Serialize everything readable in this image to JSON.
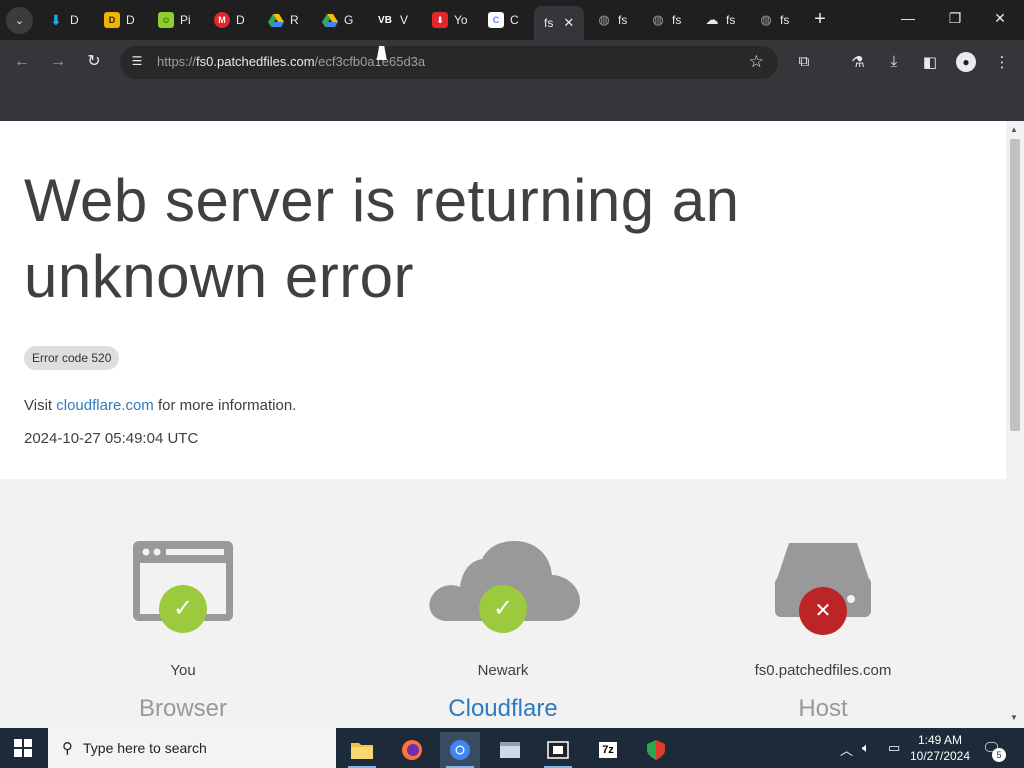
{
  "tabs": [
    {
      "label": "D",
      "icon": "download-icon",
      "color": "#1ea7e1"
    },
    {
      "label": "D",
      "icon": "d-icon",
      "color": "#f0b400"
    },
    {
      "label": "Pi",
      "icon": "smile-icon",
      "color": "#8ad12b"
    },
    {
      "label": "D",
      "icon": "m-icon",
      "color": "#e3262a"
    },
    {
      "label": "R",
      "icon": "drive-icon",
      "color": "#34a853"
    },
    {
      "label": "G",
      "icon": "drive-icon",
      "color": "#34a853"
    },
    {
      "label": "V",
      "icon": "vb-icon",
      "color": "#ffffff"
    },
    {
      "label": "Yo",
      "icon": "download-red-icon",
      "color": "#e3262a"
    },
    {
      "label": "C",
      "icon": "c-icon",
      "color": "#4c8bf5"
    },
    {
      "label": "fs",
      "icon": "",
      "color": "#35363a",
      "active": true
    },
    {
      "label": "fs",
      "icon": "globe-icon",
      "color": "#9aa0a6"
    },
    {
      "label": "fs",
      "icon": "globe-icon",
      "color": "#9aa0a6"
    },
    {
      "label": "fs",
      "icon": "cloud-icon",
      "color": "#e8eaed"
    },
    {
      "label": "fs",
      "icon": "globe-icon",
      "color": "#9aa0a6"
    }
  ],
  "address": {
    "scheme": "https://",
    "host": "fs0.patchedfiles.com",
    "path": "/ecf3cfb0a1e65d3a"
  },
  "page": {
    "headline": "Web server is returning an unknown error",
    "error_code": "Error code 520",
    "visit_prefix": "Visit",
    "visit_link": "cloudflare.com",
    "visit_suffix": "for more information.",
    "timestamp": "2024-10-27 05:49:04 UTC"
  },
  "diagram": [
    {
      "location": "You",
      "role": "Browser",
      "status": "ok"
    },
    {
      "location": "Newark",
      "role": "Cloudflare",
      "status": "ok"
    },
    {
      "location": "fs0.patchedfiles.com",
      "role": "Host",
      "status": "error"
    }
  ],
  "taskbar": {
    "search_placeholder": "Type here to search",
    "time": "1:49 AM",
    "date": "10/27/2024",
    "notification_count": "5"
  }
}
